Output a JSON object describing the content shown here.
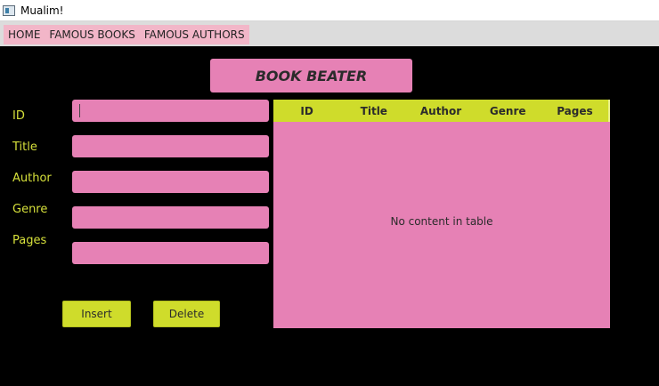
{
  "window": {
    "title": "Mualim!"
  },
  "menu": {
    "items": [
      {
        "label": "HOME"
      },
      {
        "label": "FAMOUS BOOKS"
      },
      {
        "label": "FAMOUS AUTHORS"
      }
    ]
  },
  "banner": {
    "title": "BOOK BEATER"
  },
  "form": {
    "fields": [
      {
        "label": "ID",
        "value": ""
      },
      {
        "label": "Title",
        "value": ""
      },
      {
        "label": "Author",
        "value": ""
      },
      {
        "label": "Genre",
        "value": ""
      },
      {
        "label": "Pages",
        "value": ""
      }
    ],
    "insert_label": "Insert",
    "delete_label": "Delete"
  },
  "table": {
    "columns": [
      "ID",
      "Title",
      "Author",
      "Genre",
      "Pages"
    ],
    "rows": [],
    "empty_message": "No content in table"
  },
  "colors": {
    "pink": "#e681b5",
    "lime": "#cfdc2b",
    "label_yellow": "#d6e03b",
    "background": "#000000",
    "menu_item": "#f2b6c8"
  }
}
